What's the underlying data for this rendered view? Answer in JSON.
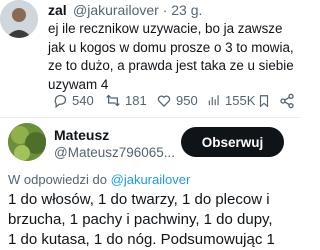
{
  "tweet1": {
    "author_name": "zal",
    "handle": "@jakurailover",
    "separator": "·",
    "time": "23 g.",
    "body_lines": [
      "ej ile recznikow uzywacie, bo ja zawsze",
      "jak u kogos w domu prosze o 3 to mowia,",
      "ze to dużo, a prawda jest taka ze u siebie",
      "uzywam 4"
    ],
    "stats": {
      "replies": "540",
      "reposts": "181",
      "likes": "950",
      "views": "155K"
    },
    "icons": [
      "reply-icon",
      "repost-icon",
      "like-icon",
      "views-icon",
      "bookmark-icon",
      "share-icon"
    ]
  },
  "tweet2": {
    "author_name": "Mateusz",
    "handle": "@Mateusz796065...",
    "follow_label": "Obserwuj",
    "reply_prefix": "W odpowiedzi do",
    "reply_to_handle": "@jakurailover",
    "body_lines": [
      "1 do włosów, 1 do twarzy, 1 do plecow i",
      "brzucha, 1 pachy i pachwiny, 1 do dupy,",
      "1 do kutasa, 1 do nóg. Podsumowując 1"
    ]
  },
  "colors": {
    "text": "#0f1419",
    "secondary": "#536471",
    "link": "#1d9bf0",
    "button_bg": "#0f1419"
  }
}
